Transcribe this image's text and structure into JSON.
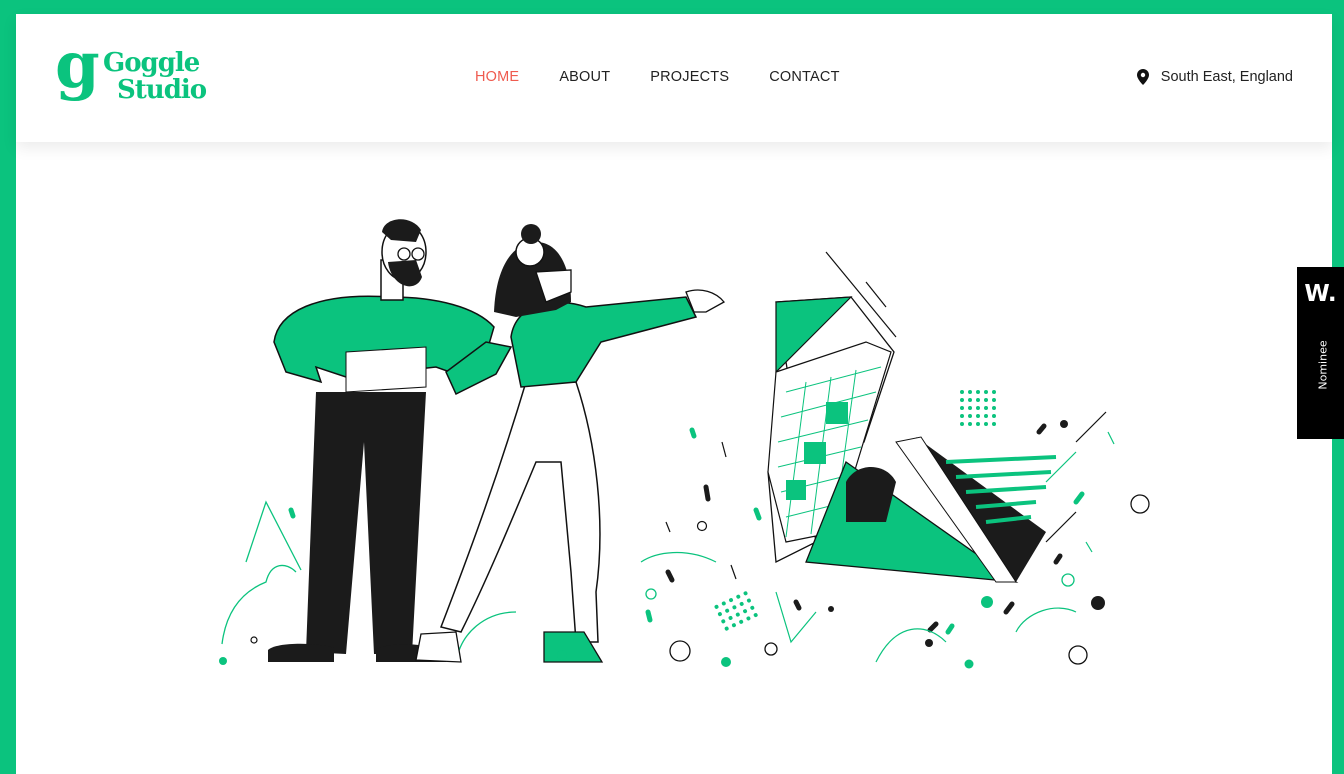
{
  "brand": {
    "logo_mark": "g",
    "name_line1": "Goggle",
    "name_line2": "Studio",
    "accent_color": "#0bc37e",
    "active_color": "#ef5b4f"
  },
  "nav": {
    "items": [
      {
        "label": "HOME",
        "active": true
      },
      {
        "label": "ABOUT",
        "active": false
      },
      {
        "label": "PROJECTS",
        "active": false
      },
      {
        "label": "CONTACT",
        "active": false
      }
    ]
  },
  "location": {
    "icon": "map-pin-icon",
    "text": "South East, England"
  },
  "hero": {
    "illustration": "two-people-with-origami-swan"
  },
  "award_badge": {
    "mark": "W.",
    "label": "Nominee"
  }
}
